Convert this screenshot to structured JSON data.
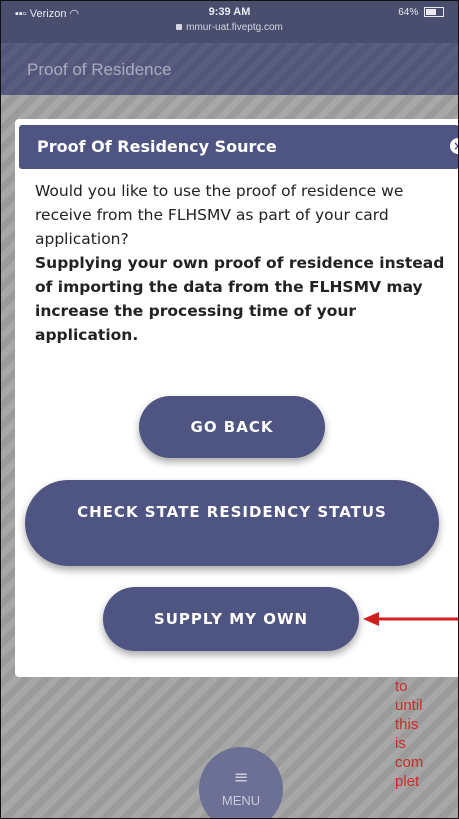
{
  "status_bar": {
    "carrier": "Verizon",
    "time": "9:39 AM",
    "url": "mmur-uat.fiveptg.com",
    "battery": "64%",
    "battery_level": 0.64
  },
  "page": {
    "title": "Proof of Residence"
  },
  "modal": {
    "title": "Proof Of Residency Source",
    "close_icon": "×",
    "question": "Would you like to use the proof of residence we receive from the FLHSMV as part of your card application?",
    "warning": "Supplying your own proof of residence instead of importing the data from the FLHSMV may increase the processing time of your application."
  },
  "buttons": {
    "go_back": "GO BACK",
    "check_status": "CHECK STATE RESIDENCY STATUS",
    "supply_own": "SUPPLY MY OWN"
  },
  "background_text": [
    "to",
    "until",
    "this",
    "is",
    "com",
    "plet"
  ],
  "menu": {
    "icon": "≡",
    "label": "MENU"
  },
  "colors": {
    "modal_header": "#4f5583",
    "button": "#4f5583",
    "annotation_arrow": "#d11f1f",
    "red_text": "#cf2a2a"
  }
}
